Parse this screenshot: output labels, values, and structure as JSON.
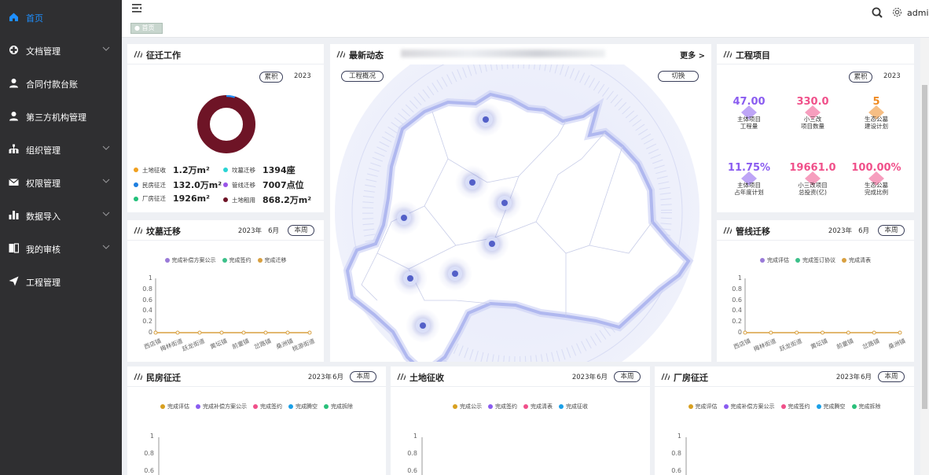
{
  "sidebar": {
    "items": [
      {
        "label": "首页",
        "icon": "home-icon",
        "active": true
      },
      {
        "label": "文档管理",
        "icon": "document-icon",
        "chevron": true
      },
      {
        "label": "合同付款台账",
        "icon": "user-icon"
      },
      {
        "label": "第三方机构管理",
        "icon": "user-icon"
      },
      {
        "label": "组织管理",
        "icon": "org-tree-icon",
        "chevron": true
      },
      {
        "label": "权限管理",
        "icon": "mail-icon",
        "chevron": true
      },
      {
        "label": "数据导入",
        "icon": "bar-chart-icon",
        "chevron": true
      },
      {
        "label": "我的审核",
        "icon": "review-icon",
        "chevron": true
      },
      {
        "label": "工程管理",
        "icon": "send-icon"
      }
    ]
  },
  "topbar": {
    "user": "admi",
    "tag": "首页"
  },
  "colors": {
    "accent": "#1e8fff",
    "sidebar": "#2f2f31",
    "donut": "#6e1426"
  },
  "relocation": {
    "title": "征迁工作",
    "pill": "累积",
    "year": "2023",
    "donut": {
      "main": 0.97,
      "accent": 0.03
    },
    "stats": [
      {
        "label": "土地征收",
        "value": "1.2万m²",
        "color": "#f0a020"
      },
      {
        "label": "坟墓迁移",
        "value": "1394座",
        "color": "#2ad4d4"
      },
      {
        "label": "民房征迁",
        "value": "132.0万m²",
        "color": "#1e7fe0"
      },
      {
        "label": "管线迁移",
        "value": "7007点位",
        "color": "#9a55e8"
      },
      {
        "label": "厂房征迁",
        "value": "1926m²",
        "color": "#22c07a"
      },
      {
        "label": "土地租用",
        "value": "868.2万m²",
        "color": "#6e1426"
      }
    ]
  },
  "news": {
    "title": "最新动态",
    "more": "更多 >",
    "overview": "工程概况",
    "switch": "切换"
  },
  "projects": {
    "title": "工程项目",
    "pill": "累积",
    "year": "2023",
    "kpis": [
      {
        "value": "47.00",
        "label": "主体项目\n工程量",
        "color": "#8a5cf0"
      },
      {
        "value": "330.0",
        "label": "小三改\n项目数量",
        "color": "#f0508a"
      },
      {
        "value": "5",
        "label": "生态公墓\n建设计划",
        "color": "#f08a20"
      },
      {
        "value": "11.75%",
        "label": "主体项目\n占年度计划",
        "color": "#8a5cf0"
      },
      {
        "value": "19661.0",
        "label": "小三改项目\n总投资(亿)",
        "color": "#f0508a"
      },
      {
        "value": "100.00%",
        "label": "生态公墓\n完成比例",
        "color": "#f0508a"
      }
    ]
  },
  "charts": {
    "tombs": {
      "title": "坟墓迁移",
      "year": "2023年",
      "month": "6月",
      "btn": "本周",
      "legend": [
        {
          "name": "完成补偿方案公示",
          "color": "#9a7ad8"
        },
        {
          "name": "完成签约",
          "color": "#3cc08a"
        },
        {
          "name": "完成迁移",
          "color": "#d8a040"
        }
      ]
    },
    "pipes": {
      "title": "管线迁移",
      "year": "2023年",
      "month": "6月",
      "btn": "本周",
      "legend": [
        {
          "name": "完成评估",
          "color": "#9a7ad8"
        },
        {
          "name": "完成签订协议",
          "color": "#3cc08a"
        },
        {
          "name": "完成清表",
          "color": "#d8a040"
        }
      ]
    },
    "houses": {
      "title": "民房征迁",
      "year": "2023年",
      "month": "6月",
      "btn": "本周",
      "legend": [
        {
          "name": "完成评估",
          "color": "#d8a020"
        },
        {
          "name": "完成补偿方案公示",
          "color": "#8a5cf0"
        },
        {
          "name": "完成签约",
          "color": "#f0508a"
        },
        {
          "name": "完成腾空",
          "color": "#1aa0e8"
        },
        {
          "name": "完成拆除",
          "color": "#2ac07a"
        }
      ]
    },
    "land": {
      "title": "土地征收",
      "year": "2023年",
      "month": "6月",
      "btn": "本周",
      "legend": [
        {
          "name": "完成公示",
          "color": "#d8a020"
        },
        {
          "name": "完成签约",
          "color": "#8a5cf0"
        },
        {
          "name": "完成清表",
          "color": "#f0508a"
        },
        {
          "name": "完成征收",
          "color": "#1aa0e8"
        }
      ]
    },
    "factory": {
      "title": "厂房征迁",
      "year": "2023年",
      "month": "6月",
      "btn": "本周",
      "legend": [
        {
          "name": "完成评估",
          "color": "#d8a020"
        },
        {
          "name": "完成补偿方案公示",
          "color": "#8a5cf0"
        },
        {
          "name": "完成签约",
          "color": "#f0508a"
        },
        {
          "name": "完成腾空",
          "color": "#1aa0e8"
        },
        {
          "name": "完成拆除",
          "color": "#2ac07a"
        }
      ]
    }
  },
  "chart_data": [
    {
      "type": "line",
      "ylim": [
        0,
        1
      ],
      "yticks": [
        "1",
        "0.8",
        "0.6",
        "0.4",
        "0.2",
        "0"
      ],
      "categories": [
        "西店镇",
        "梅林街道",
        "跃龙街道",
        "黄坛镇",
        "前童镇",
        "岔路镇",
        "桑洲镇",
        "桃源街道"
      ],
      "series": [
        {
          "name": "完成补偿方案公示",
          "values": [
            0,
            0,
            0,
            0,
            0,
            0,
            0,
            0
          ]
        },
        {
          "name": "完成签约",
          "values": [
            0,
            0,
            0,
            0,
            0,
            0,
            0,
            0
          ]
        },
        {
          "name": "完成迁移",
          "values": [
            0,
            0,
            0,
            0,
            0,
            0,
            0,
            0
          ]
        }
      ]
    },
    {
      "type": "line",
      "ylim": [
        0,
        1
      ],
      "yticks": [
        "1",
        "0.8",
        "0.6",
        "0.4",
        "0.2",
        "0"
      ],
      "categories": [
        "西店镇",
        "梅林街道",
        "跃龙街道",
        "黄坛镇",
        "前童镇",
        "岔路镇",
        "桑洲镇"
      ],
      "series": [
        {
          "name": "完成评估",
          "values": [
            0,
            0,
            0,
            0,
            0,
            0,
            0
          ]
        },
        {
          "name": "完成签订协议",
          "values": [
            0,
            0,
            0,
            0,
            0,
            0,
            0
          ]
        },
        {
          "name": "完成清表",
          "values": [
            0,
            0,
            0,
            0,
            0,
            0,
            0
          ]
        }
      ]
    }
  ],
  "yticks_small": [
    "1",
    "0.8",
    "0.6"
  ]
}
